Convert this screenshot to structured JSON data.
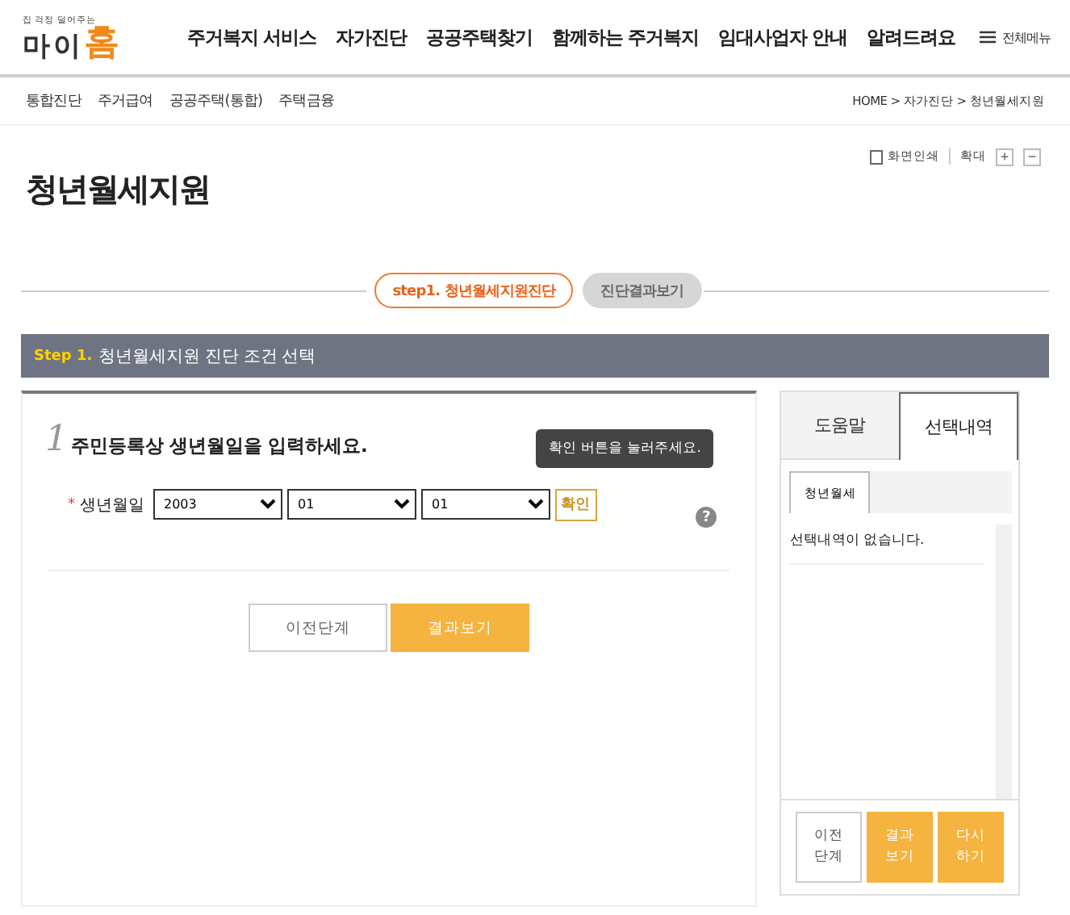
{
  "header": {
    "logo_tagline": "집 걱정 덜어주는",
    "logo_text": "마이",
    "logo_accent": "홈",
    "nav": [
      "주거복지 서비스",
      "자가진단",
      "공공주택찾기",
      "함께하는 주거복지",
      "임대사업자 안내",
      "알려드려요"
    ],
    "all_menu": "전체메뉴"
  },
  "subnav": {
    "items": [
      "통합진단",
      "주거급여",
      "공공주택(통합)",
      "주택금융"
    ],
    "breadcrumb": "HOME > 자가진단 > 청년월세지원"
  },
  "tools": {
    "print": "화면인쇄",
    "zoom": "확대",
    "zoom_in": "+",
    "zoom_out": "−"
  },
  "page_title": "청년월세지원",
  "steps": [
    {
      "label": "step1. 청년월세지원진단",
      "selected": true
    },
    {
      "label": "진단결과보기",
      "selected": false
    }
  ],
  "section": {
    "step": "Step 1.",
    "title": "청년월세지원 진단 조건 선택"
  },
  "question": {
    "number": "1",
    "text": "주민등록상 생년월일을 입력하세요.",
    "required_mark": "*",
    "label": "생년월일",
    "selects": [
      "2003",
      "01",
      "01"
    ],
    "confirm": "확인",
    "tooltip": "확인 버튼을 눌러주세요.",
    "help": "?"
  },
  "buttons": [
    {
      "label": "이전단계",
      "kind": "secondary"
    },
    {
      "label": "결과보기",
      "kind": "primary"
    }
  ],
  "side": {
    "tabs": [
      {
        "label": "도움말",
        "selected": false
      },
      {
        "label": "선택내역",
        "selected": true
      }
    ],
    "subtabs": [
      {
        "label": "청년월세",
        "selected": true
      }
    ],
    "empty": "선택내역이 없습니다.",
    "buttons": [
      {
        "label": "이전단계",
        "kind": "secondary"
      },
      {
        "label": "결과보기",
        "kind": "primary"
      },
      {
        "label": "다시하기",
        "kind": "primary"
      }
    ]
  }
}
